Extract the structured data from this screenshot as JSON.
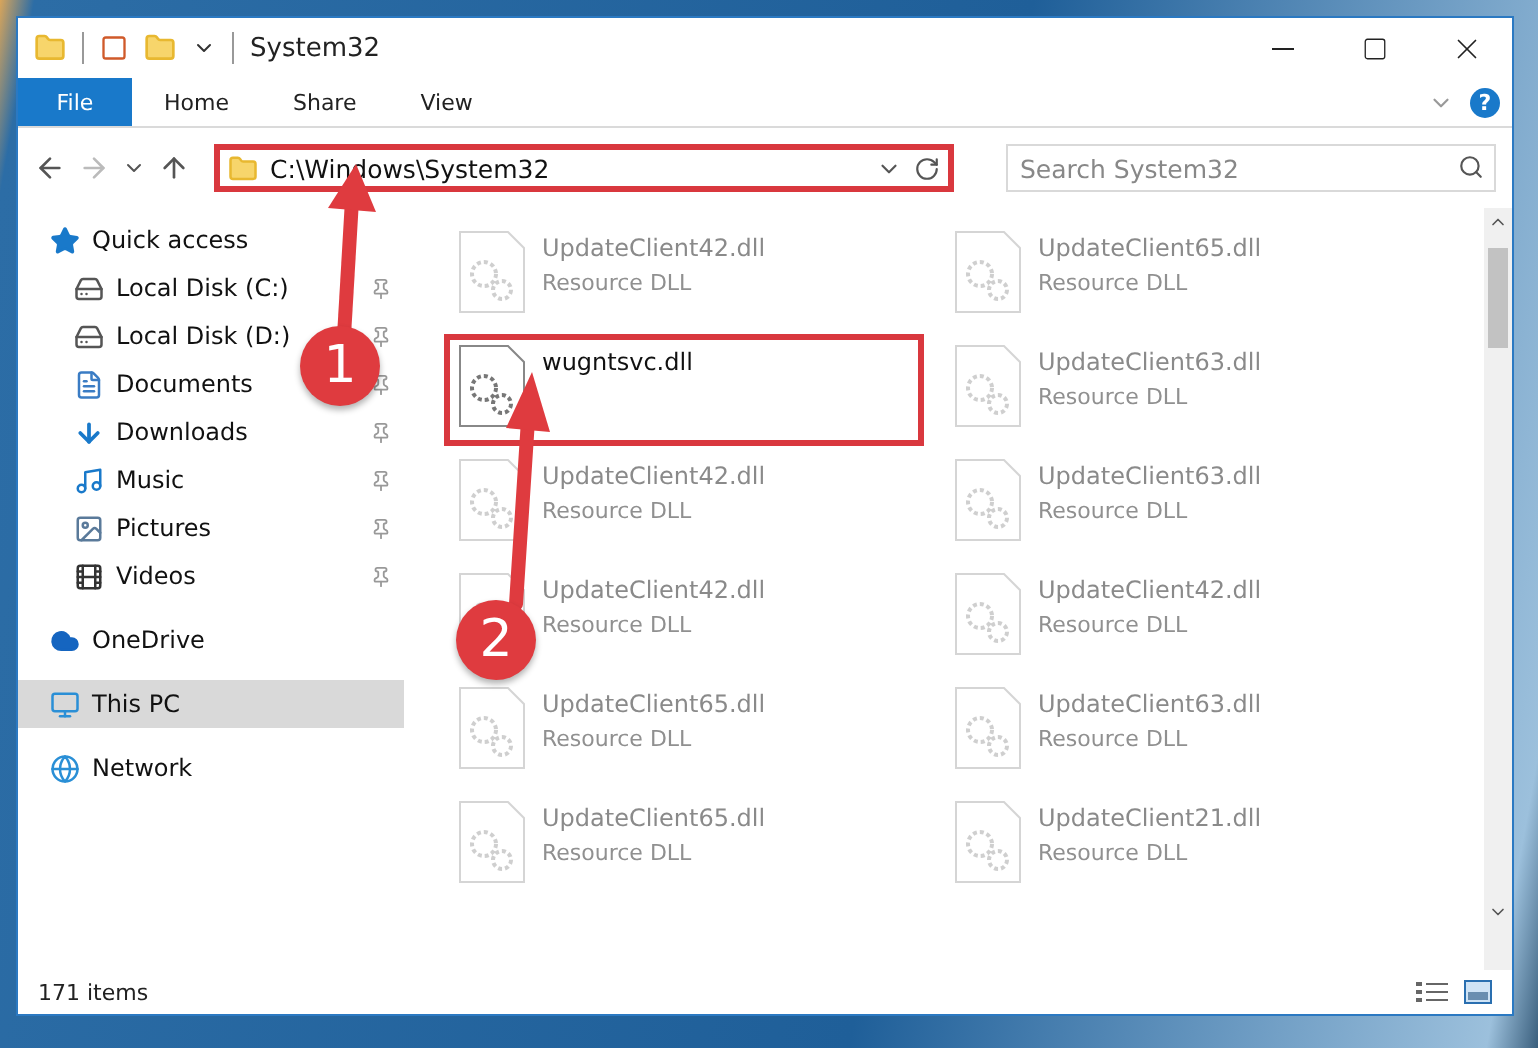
{
  "window": {
    "title": "System32"
  },
  "ribbon": {
    "tabs": [
      {
        "label": "File",
        "selected": true
      },
      {
        "label": "Home",
        "selected": false
      },
      {
        "label": "Share",
        "selected": false
      },
      {
        "label": "View",
        "selected": false
      }
    ],
    "help": "?"
  },
  "address_bar": {
    "path": "C:\\Windows\\System32",
    "highlighted": true
  },
  "search": {
    "placeholder": "Search System32"
  },
  "sidebar": {
    "items": [
      {
        "label": "Quick access",
        "selected": false,
        "children": [
          {
            "label": "Local Disk (C:)",
            "pinned": true,
            "selected": false
          },
          {
            "label": "Local Disk (D:)",
            "pinned": true,
            "selected": false
          },
          {
            "label": "Documents",
            "pinned": true,
            "selected": false
          },
          {
            "label": "Downloads",
            "pinned": true,
            "selected": false
          },
          {
            "label": "Music",
            "pinned": true,
            "selected": false
          },
          {
            "label": "Pictures",
            "pinned": true,
            "selected": false
          },
          {
            "label": "Videos",
            "pinned": true,
            "selected": false
          }
        ]
      },
      {
        "label": "OneDrive",
        "selected": false
      },
      {
        "label": "This PC",
        "selected": true
      },
      {
        "label": "Network",
        "selected": false
      }
    ]
  },
  "files": [
    {
      "name": "UpdateClient42.dll",
      "type": "Resource DLL",
      "faded": true,
      "highlighted": false
    },
    {
      "name": "UpdateClient65.dll",
      "type": "Resource DLL",
      "faded": true,
      "highlighted": false
    },
    {
      "name": "wugntsvc.dll",
      "faded": false,
      "highlighted": true
    },
    {
      "name": "UpdateClient63.dll",
      "type": "Resource DLL",
      "faded": true,
      "highlighted": false
    },
    {
      "name": "UpdateClient42.dll",
      "type": "Resource DLL",
      "faded": true,
      "highlighted": false
    },
    {
      "name": "UpdateClient63.dll",
      "type": "Resource DLL",
      "faded": true,
      "highlighted": false
    },
    {
      "name": "UpdateClient42.dll",
      "type": "Resource DLL",
      "faded": true,
      "highlighted": false
    },
    {
      "name": "UpdateClient42.dll",
      "type": "Resource DLL",
      "faded": true,
      "highlighted": false
    },
    {
      "name": "UpdateClient65.dll",
      "type": "Resource DLL",
      "faded": true,
      "highlighted": false
    },
    {
      "name": "UpdateClient63.dll",
      "type": "Resource DLL",
      "faded": true,
      "highlighted": false
    },
    {
      "name": "UpdateClient65.dll",
      "type": "Resource DLL",
      "faded": true,
      "highlighted": false
    },
    {
      "name": "UpdateClient21.dll",
      "type": "Resource DLL",
      "faded": true,
      "highlighted": false
    }
  ],
  "status_bar": {
    "item_count": "171 items"
  },
  "callouts": [
    {
      "number": "1"
    },
    {
      "number": "2"
    }
  ]
}
